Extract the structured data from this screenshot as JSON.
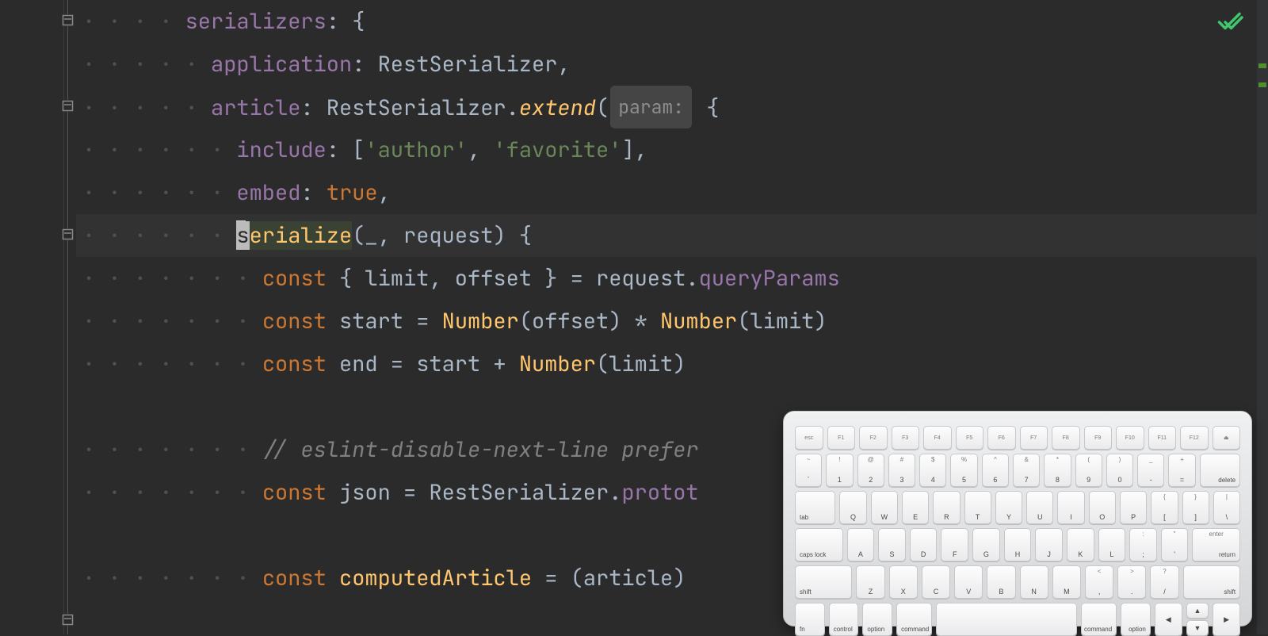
{
  "editor": {
    "indent_marker": "·",
    "active_line_index": 5,
    "fold_markers": [
      0,
      2,
      5,
      14
    ],
    "bulb_line": 5,
    "inspection_status": "ok",
    "marker_strip": [
      {
        "color": "green",
        "top_pct": 10
      },
      {
        "color": "green",
        "top_pct": 13
      }
    ],
    "lines": [
      {
        "indent": 4,
        "tokens": [
          {
            "t": "prop",
            "v": "serializers"
          },
          {
            "t": "p",
            "v": ": {"
          }
        ]
      },
      {
        "indent": 5,
        "tokens": [
          {
            "t": "prop",
            "v": "application"
          },
          {
            "t": "p",
            "v": ": RestSerializer,"
          }
        ]
      },
      {
        "indent": 5,
        "tokens": [
          {
            "t": "prop",
            "v": "article"
          },
          {
            "t": "p",
            "v": ": RestSerializer."
          },
          {
            "t": "fn",
            "v": "extend"
          },
          {
            "t": "p",
            "v": "("
          },
          {
            "t": "hint",
            "v": "param:"
          },
          {
            "t": "p",
            "v": " {"
          }
        ]
      },
      {
        "indent": 6,
        "tokens": [
          {
            "t": "prop",
            "v": "include"
          },
          {
            "t": "p",
            "v": ": ["
          },
          {
            "t": "s",
            "v": "'author'"
          },
          {
            "t": "p",
            "v": ", "
          },
          {
            "t": "s",
            "v": "'favorite'"
          },
          {
            "t": "p",
            "v": "],"
          }
        ]
      },
      {
        "indent": 6,
        "tokens": [
          {
            "t": "prop",
            "v": "embed"
          },
          {
            "t": "p",
            "v": ": "
          },
          {
            "t": "k",
            "v": "true"
          },
          {
            "t": "p",
            "v": ","
          }
        ]
      },
      {
        "indent": 6,
        "tokens": [
          {
            "t": "caret"
          },
          {
            "t": "sel",
            "v": "s"
          },
          {
            "t": "sel-m",
            "v": "erialize"
          },
          {
            "t": "p",
            "v": "(_, request) {"
          }
        ],
        "active": true
      },
      {
        "indent": 7,
        "tokens": [
          {
            "t": "k",
            "v": "const"
          },
          {
            "t": "p",
            "v": " { limit, offset } = request."
          },
          {
            "t": "prop",
            "v": "queryParams"
          }
        ]
      },
      {
        "indent": 7,
        "tokens": [
          {
            "t": "k",
            "v": "const"
          },
          {
            "t": "p",
            "v": " start = "
          },
          {
            "t": "m",
            "v": "Number"
          },
          {
            "t": "p",
            "v": "(offset) * "
          },
          {
            "t": "m",
            "v": "Number"
          },
          {
            "t": "p",
            "v": "(limit)"
          }
        ]
      },
      {
        "indent": 7,
        "tokens": [
          {
            "t": "k",
            "v": "const"
          },
          {
            "t": "p",
            "v": " end = start + "
          },
          {
            "t": "m",
            "v": "Number"
          },
          {
            "t": "p",
            "v": "(limit)"
          }
        ]
      },
      {
        "indent": 0,
        "tokens": []
      },
      {
        "indent": 7,
        "tokens": [
          {
            "t": "c",
            "v": "// eslint-disable-next-line prefer"
          }
        ]
      },
      {
        "indent": 7,
        "tokens": [
          {
            "t": "k",
            "v": "const"
          },
          {
            "t": "p",
            "v": " json = RestSerializer."
          },
          {
            "t": "prop",
            "v": "protot"
          }
        ]
      },
      {
        "indent": 0,
        "tokens": []
      },
      {
        "indent": 7,
        "tokens": [
          {
            "t": "k",
            "v": "const"
          },
          {
            "t": "p",
            "v": " "
          },
          {
            "t": "m",
            "v": "computedArticle"
          },
          {
            "t": "p",
            "v": " = (article)"
          }
        ]
      }
    ]
  },
  "keyboard": {
    "fn_row": [
      "esc",
      "F1",
      "F2",
      "F3",
      "F4",
      "F5",
      "F6",
      "F7",
      "F8",
      "F9",
      "F10",
      "F11",
      "F12",
      "⏏"
    ],
    "row1": [
      {
        "b": "`",
        "t": "~"
      },
      {
        "b": "1",
        "t": "!"
      },
      {
        "b": "2",
        "t": "@"
      },
      {
        "b": "3",
        "t": "#"
      },
      {
        "b": "4",
        "t": "$"
      },
      {
        "b": "5",
        "t": "%"
      },
      {
        "b": "6",
        "t": "^"
      },
      {
        "b": "7",
        "t": "&"
      },
      {
        "b": "8",
        "t": "*"
      },
      {
        "b": "9",
        "t": "("
      },
      {
        "b": "0",
        "t": ")"
      },
      {
        "b": "-",
        "t": "_"
      },
      {
        "b": "=",
        "t": "+"
      },
      {
        "b": "delete",
        "cls": "wide-15 lowr"
      }
    ],
    "row2": [
      {
        "b": "tab",
        "cls": "wide-15 low"
      },
      {
        "b": "Q"
      },
      {
        "b": "W"
      },
      {
        "b": "E"
      },
      {
        "b": "R"
      },
      {
        "b": "T"
      },
      {
        "b": "Y"
      },
      {
        "b": "U"
      },
      {
        "b": "I"
      },
      {
        "b": "O"
      },
      {
        "b": "P"
      },
      {
        "b": "[",
        "t": "{"
      },
      {
        "b": "]",
        "t": "}"
      },
      {
        "b": "\\",
        "t": "|"
      }
    ],
    "row3": [
      {
        "b": "caps lock",
        "cls": "wide-175 low"
      },
      {
        "b": "A"
      },
      {
        "b": "S"
      },
      {
        "b": "D"
      },
      {
        "b": "F"
      },
      {
        "b": "G"
      },
      {
        "b": "H"
      },
      {
        "b": "J"
      },
      {
        "b": "K"
      },
      {
        "b": "L"
      },
      {
        "b": ";",
        "t": ":"
      },
      {
        "b": "'",
        "t": "\""
      },
      {
        "b": "return",
        "cls": "wide-175 lowr",
        "t": "enter"
      }
    ],
    "row4": [
      {
        "b": "shift",
        "cls": "wide-2 low"
      },
      {
        "b": "Z"
      },
      {
        "b": "X"
      },
      {
        "b": "C"
      },
      {
        "b": "V"
      },
      {
        "b": "B"
      },
      {
        "b": "N"
      },
      {
        "b": "M"
      },
      {
        "b": ",",
        "t": "<"
      },
      {
        "b": ".",
        "t": ">"
      },
      {
        "b": "/",
        "t": "?"
      },
      {
        "b": "shift",
        "cls": "wide-2 lowr"
      }
    ],
    "row5": [
      {
        "b": "fn",
        "cls": "low"
      },
      {
        "b": "control",
        "cls": "low"
      },
      {
        "b": "option",
        "cls": "low"
      },
      {
        "b": "command",
        "cls": "wide-125 low"
      },
      {
        "b": "",
        "cls": "space"
      },
      {
        "b": "command",
        "cls": "wide-125 lowr"
      },
      {
        "b": "option",
        "cls": "lowr"
      }
    ],
    "arrows": {
      "left": "◀",
      "up": "▲",
      "down": "▼",
      "right": "▶"
    }
  }
}
